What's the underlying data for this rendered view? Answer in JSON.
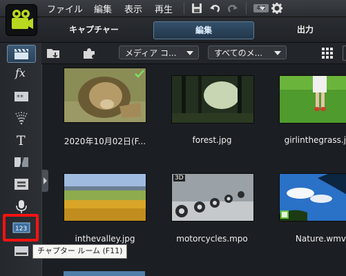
{
  "menu": {
    "items": [
      "ファイル",
      "編集",
      "表示",
      "再生"
    ],
    "ratio_badge": "4:3"
  },
  "modes": {
    "capture": "キャプチャー",
    "edit": "編集",
    "output": "出力"
  },
  "toolbar": {
    "dropdown_media": "メディア コ...",
    "dropdown_all": "すべてのメ..."
  },
  "sidebar": {
    "tooltip": "チャプター ルーム (F11)"
  },
  "library": {
    "items": [
      {
        "caption": "2020年10月02日(F...",
        "checked": true
      },
      {
        "caption": "forest.jpg"
      },
      {
        "caption": "girlinthegrass.j"
      },
      {
        "caption": "inthevalley.jpg"
      },
      {
        "caption": "motorcycles.mpo",
        "badge": "3D"
      },
      {
        "caption": "Nature.wmv"
      }
    ]
  },
  "colors": {
    "accent": "#4f7ea8",
    "highlight": "#ff1212",
    "background": "#1b1e22"
  }
}
